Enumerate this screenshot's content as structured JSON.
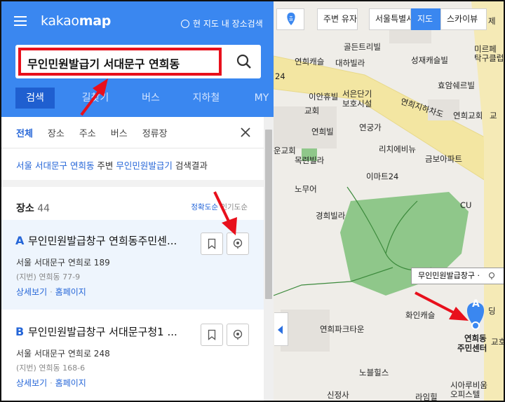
{
  "app": {
    "logo_plain": "kakao",
    "logo_bold": "map",
    "map_search_toggle": "현 지도 내 장소검색"
  },
  "search": {
    "value": "무인민원발급기 서대문구 연희동"
  },
  "topnav": [
    "검색",
    "길찾기",
    "버스",
    "지하철",
    "MY"
  ],
  "filter_tabs": [
    "전체",
    "장소",
    "주소",
    "버스",
    "정류장"
  ],
  "result_note": {
    "region": "서울 서대문구 연희동",
    "mid": " 주변 ",
    "keyword": "무인민원발급기",
    "tail": " 검색결과"
  },
  "places": {
    "label": "장소",
    "count": "44",
    "sort_active": "정확도순",
    "sort_other": "인기도순"
  },
  "results": [
    {
      "letter": "A",
      "name": "무인민원발급창구 연희동주민센...",
      "address": "서울 서대문구 연희로 189",
      "jibun": "(지번) 연희동 77-9",
      "detail_link": "상세보기",
      "dot": "·",
      "home_link": "홈페이지"
    },
    {
      "letter": "B",
      "name": "무인민원발급창구 서대문구청1 ...",
      "address": "서울 서대문구 연희로 248",
      "jibun": "(지번) 연희동 168-6",
      "detail_link": "상세보기",
      "dot": "·",
      "home_link": "홈페이지"
    }
  ],
  "map_controls": {
    "nearby": "주변",
    "nearby_cut": "유자",
    "region": "서울특별시",
    "map": "지도",
    "skyview": "스카이뷰"
  },
  "map_tooltip": "무인민원발급창구 ·",
  "map_marker_letter": "A",
  "map_labels": {
    "l1": "연희캐슬",
    "l2": "골든트리빌",
    "l3": "대하빌라",
    "l4": "성재캐슬빌",
    "l5": "미르페",
    "l6": "탁구클럽",
    "l7": "효암쉐르빌",
    "l8": "이안휴빌",
    "l9": "서은단기",
    "l10": "보호시설",
    "l11": "연희지하차도",
    "l12": "연희교회",
    "l13": "연희빌",
    "l14": "연궁가",
    "l15": "운교회",
    "l16": "리치에비뉴",
    "l17": "목련빌라",
    "l18": "금보아파트",
    "l19": "이마트24",
    "l20": "노무어",
    "l21": "경희빌라",
    "l22": "CU",
    "l23": "화인캐슬",
    "l24": "연희파크타운",
    "l25": "노블힐스",
    "l26": "신정사",
    "l27": "라임힐",
    "l28": "시아루비움",
    "l29": "오피스텔",
    "l30": "24",
    "l31": "교호",
    "l32": "연희동",
    "l33": "주민센터",
    "l34": "제",
    "l35": "교",
    "l36": "딩",
    "l37": "출",
    "l38": "교회"
  },
  "colors": {
    "brand_blue": "#3a87f0",
    "red_annotation": "#e8101c",
    "park_green": "#8fc78a"
  }
}
